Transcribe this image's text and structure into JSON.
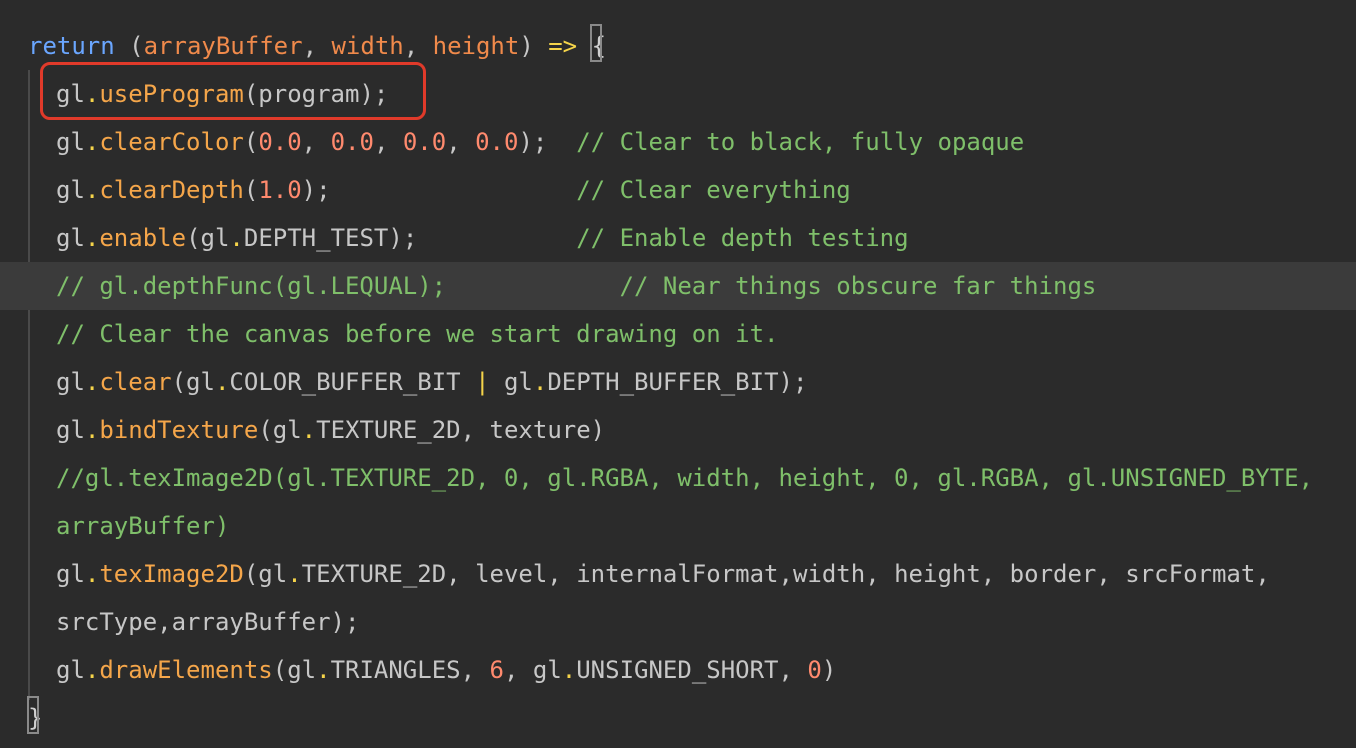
{
  "editor": {
    "colors": {
      "background": "#2b2b2b",
      "current_line": "#3b3b3b",
      "keyword": "#6aa6ff",
      "parameter": "#f08a4b",
      "function": "#f5a64a",
      "operator": "#f5d44a",
      "number": "#ff8a6e",
      "comment": "#7fbf6a",
      "text": "#c7c7c7",
      "highlight_box": "#e03a2a"
    },
    "lines": [
      [
        {
          "t": "return",
          "c": "kw"
        },
        {
          "t": " (",
          "c": "punc"
        },
        {
          "t": "arrayBuffer",
          "c": "param"
        },
        {
          "t": ", ",
          "c": "punc"
        },
        {
          "t": "width",
          "c": "param"
        },
        {
          "t": ", ",
          "c": "punc"
        },
        {
          "t": "height",
          "c": "param"
        },
        {
          "t": ") ",
          "c": "punc"
        },
        {
          "t": "=>",
          "c": "op"
        },
        {
          "t": " ",
          "c": "plain"
        },
        {
          "t": "{",
          "c": "brace"
        }
      ],
      [
        {
          "t": "gl",
          "c": "plain"
        },
        {
          "t": ".",
          "c": "op"
        },
        {
          "t": "useProgram",
          "c": "fn"
        },
        {
          "t": "(program);",
          "c": "plain"
        }
      ],
      [
        {
          "t": "gl",
          "c": "plain"
        },
        {
          "t": ".",
          "c": "op"
        },
        {
          "t": "clearColor",
          "c": "fn"
        },
        {
          "t": "(",
          "c": "punc"
        },
        {
          "t": "0.0",
          "c": "num"
        },
        {
          "t": ", ",
          "c": "punc"
        },
        {
          "t": "0.0",
          "c": "num"
        },
        {
          "t": ", ",
          "c": "punc"
        },
        {
          "t": "0.0",
          "c": "num"
        },
        {
          "t": ", ",
          "c": "punc"
        },
        {
          "t": "0.0",
          "c": "num"
        },
        {
          "t": ");  ",
          "c": "punc"
        },
        {
          "t": "// Clear to black, fully opaque",
          "c": "com"
        }
      ],
      [
        {
          "t": "gl",
          "c": "plain"
        },
        {
          "t": ".",
          "c": "op"
        },
        {
          "t": "clearDepth",
          "c": "fn"
        },
        {
          "t": "(",
          "c": "punc"
        },
        {
          "t": "1.0",
          "c": "num"
        },
        {
          "t": ");                 ",
          "c": "punc"
        },
        {
          "t": "// Clear everything",
          "c": "com"
        }
      ],
      [
        {
          "t": "gl",
          "c": "plain"
        },
        {
          "t": ".",
          "c": "op"
        },
        {
          "t": "enable",
          "c": "fn"
        },
        {
          "t": "(gl",
          "c": "plain"
        },
        {
          "t": ".",
          "c": "op"
        },
        {
          "t": "DEPTH_TEST);           ",
          "c": "plain"
        },
        {
          "t": "// Enable depth testing",
          "c": "com"
        }
      ],
      [
        {
          "t": "// gl.depthFunc(gl.LEQUAL);            // Near things obscure far things",
          "c": "com"
        }
      ],
      [
        {
          "t": "// Clear the canvas before we start drawing on it.",
          "c": "com"
        }
      ],
      [
        {
          "t": "gl",
          "c": "plain"
        },
        {
          "t": ".",
          "c": "op"
        },
        {
          "t": "clear",
          "c": "fn"
        },
        {
          "t": "(gl",
          "c": "plain"
        },
        {
          "t": ".",
          "c": "op"
        },
        {
          "t": "COLOR_BUFFER_BIT ",
          "c": "plain"
        },
        {
          "t": "|",
          "c": "op"
        },
        {
          "t": " gl",
          "c": "plain"
        },
        {
          "t": ".",
          "c": "op"
        },
        {
          "t": "DEPTH_BUFFER_BIT);",
          "c": "plain"
        }
      ],
      [
        {
          "t": "gl",
          "c": "plain"
        },
        {
          "t": ".",
          "c": "op"
        },
        {
          "t": "bindTexture",
          "c": "fn"
        },
        {
          "t": "(gl",
          "c": "plain"
        },
        {
          "t": ".",
          "c": "op"
        },
        {
          "t": "TEXTURE_2D, texture)",
          "c": "plain"
        }
      ],
      [
        {
          "t": "//gl.texImage2D(gl.TEXTURE_2D, 0, gl.RGBA, width, height, 0, gl.RGBA, gl.UNSIGNED_BYTE,",
          "c": "com"
        }
      ],
      [
        {
          "t": "arrayBuffer)",
          "c": "com"
        }
      ],
      [
        {
          "t": "gl",
          "c": "plain"
        },
        {
          "t": ".",
          "c": "op"
        },
        {
          "t": "texImage2D",
          "c": "fn"
        },
        {
          "t": "(gl",
          "c": "plain"
        },
        {
          "t": ".",
          "c": "op"
        },
        {
          "t": "TEXTURE_2D, level, internalFormat,width, height, border, srcFormat,",
          "c": "plain"
        }
      ],
      [
        {
          "t": "srcType,arrayBuffer);",
          "c": "plain"
        }
      ],
      [
        {
          "t": "gl",
          "c": "plain"
        },
        {
          "t": ".",
          "c": "op"
        },
        {
          "t": "drawElements",
          "c": "fn"
        },
        {
          "t": "(gl",
          "c": "plain"
        },
        {
          "t": ".",
          "c": "op"
        },
        {
          "t": "TRIANGLES, ",
          "c": "plain"
        },
        {
          "t": "6",
          "c": "num"
        },
        {
          "t": ", gl",
          "c": "plain"
        },
        {
          "t": ".",
          "c": "op"
        },
        {
          "t": "UNSIGNED_SHORT, ",
          "c": "plain"
        },
        {
          "t": "0",
          "c": "num"
        },
        {
          "t": ")",
          "c": "plain"
        }
      ],
      [
        {
          "t": "}",
          "c": "brace"
        }
      ]
    ]
  }
}
